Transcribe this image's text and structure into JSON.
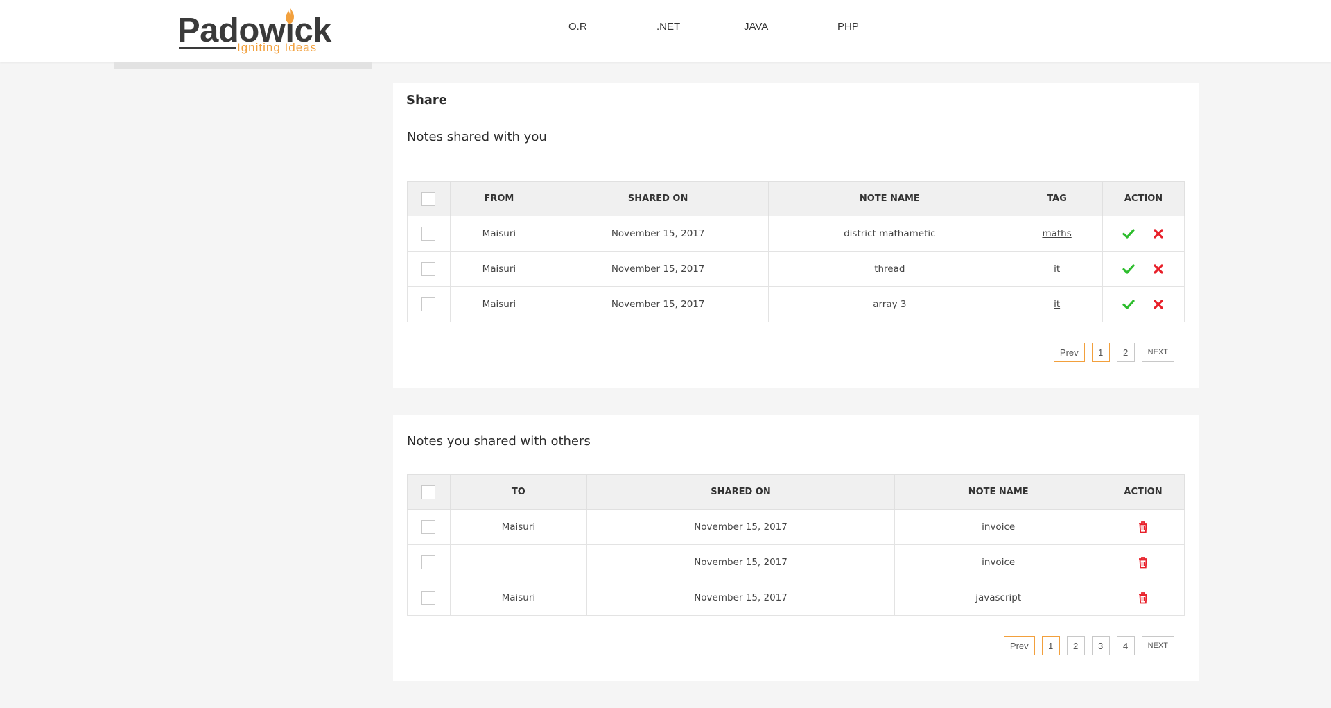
{
  "brand": {
    "name": "Padowick",
    "tagline": "Igniting Ideas",
    "flame_color": "#f2a03d"
  },
  "nav": [
    {
      "label": "O.R"
    },
    {
      "label": ".NET"
    },
    {
      "label": "JAVA"
    },
    {
      "label": "PHP"
    }
  ],
  "share_panel": {
    "title": "Share",
    "section_title": "Notes shared with you",
    "columns": [
      "FROM",
      "SHARED ON",
      "NOTE NAME",
      "TAG",
      "ACTION"
    ],
    "rows": [
      {
        "from": "Maisuri",
        "shared_on": "November 15, 2017",
        "note_name": "district mathametic",
        "tag": "maths"
      },
      {
        "from": "Maisuri",
        "shared_on": "November 15, 2017",
        "note_name": "thread",
        "tag": "it"
      },
      {
        "from": "Maisuri",
        "shared_on": "November 15, 2017",
        "note_name": "array 3",
        "tag": "it"
      }
    ],
    "pager": {
      "prev": "Prev",
      "pages": [
        "1",
        "2"
      ],
      "next": "NEXT",
      "current": "1"
    }
  },
  "others_panel": {
    "section_title": "Notes you shared with others",
    "columns": [
      "TO",
      "SHARED ON",
      "NOTE NAME",
      "ACTION"
    ],
    "rows": [
      {
        "to": "Maisuri",
        "shared_on": "November 15, 2017",
        "note_name": "invoice"
      },
      {
        "to": "",
        "shared_on": "November 15, 2017",
        "note_name": "invoice"
      },
      {
        "to": "Maisuri",
        "shared_on": "November 15, 2017",
        "note_name": "javascript"
      }
    ],
    "pager": {
      "prev": "Prev",
      "pages": [
        "1",
        "2",
        "3",
        "4"
      ],
      "next": "NEXT",
      "current": "1"
    }
  },
  "colors": {
    "accent": "#f2a03d",
    "accept": "#2dbd2d",
    "reject": "#e8202a",
    "delete": "#e8202a"
  },
  "icons": {
    "accept": "check-icon",
    "reject": "close-icon",
    "delete": "trash-icon"
  }
}
